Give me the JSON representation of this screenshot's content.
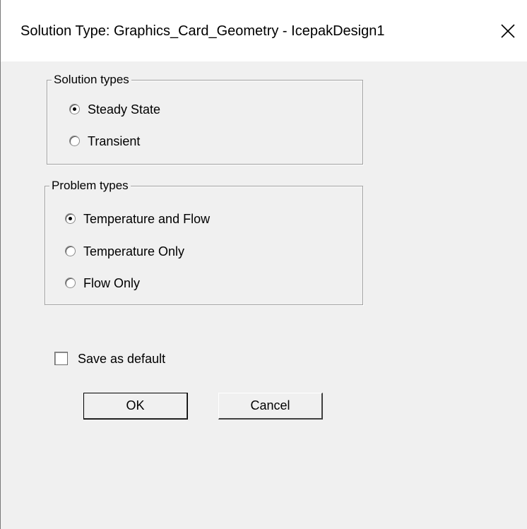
{
  "window": {
    "title": "Solution Type: Graphics_Card_Geometry - IcepakDesign1",
    "close_icon": "close-icon"
  },
  "solution_types": {
    "legend": "Solution types",
    "options": [
      {
        "label": "Steady State",
        "selected": true
      },
      {
        "label": "Transient",
        "selected": false
      }
    ]
  },
  "problem_types": {
    "legend": "Problem types",
    "options": [
      {
        "label": "Temperature and Flow",
        "selected": true
      },
      {
        "label": "Temperature Only",
        "selected": false
      },
      {
        "label": "Flow Only",
        "selected": false
      }
    ]
  },
  "save_default": {
    "label": "Save as default",
    "checked": false
  },
  "buttons": {
    "ok": "OK",
    "cancel": "Cancel"
  }
}
